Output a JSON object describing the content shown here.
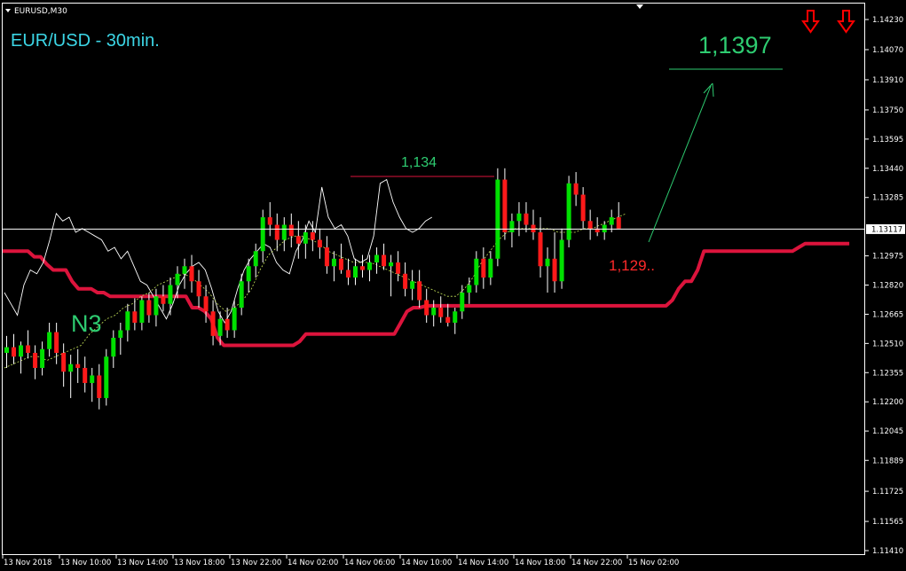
{
  "window": {
    "symbol_label": "EURUSD,M30"
  },
  "annotations": {
    "title": "EUR/USD - 30min.",
    "wave_label": "N3",
    "resistance_label": "1,134",
    "support_label": "1,129..",
    "target_label": "1,1397"
  },
  "price_axis": {
    "current_price": "1.13117"
  },
  "colors": {
    "background": "#000000",
    "bull_candle": "#00e000",
    "bear_candle": "#ff1a1a",
    "kijun_line": "#dc143c",
    "text_cyan": "#3cd6e6",
    "text_green": "#2ecc71",
    "text_red": "#ff2a2a",
    "arrow_red": "#ff0000"
  },
  "icons": [
    "down-arrow-icon",
    "down-arrow-icon",
    "collapse-triangle-icon",
    "expand-triangle-icon"
  ],
  "chart_data": {
    "type": "candlestick",
    "symbol": "EURUSD",
    "timeframe": "M30",
    "ylim": [
      1.1141,
      1.1423
    ],
    "yticks": [
      "1.14230",
      "1.14070",
      "1.13910",
      "1.13750",
      "1.13595",
      "1.13440",
      "1.13285",
      "1.13117",
      "1.12975",
      "1.12820",
      "1.12665",
      "1.12510",
      "1.12355",
      "1.12200",
      "1.12045",
      "1.11889",
      "1.11725",
      "1.11565",
      "1.11410"
    ],
    "xticks": [
      "13 Nov 2018",
      "13 Nov 10:00",
      "13 Nov 14:00",
      "13 Nov 18:00",
      "13 Nov 22:00",
      "14 Nov 02:00",
      "14 Nov 06:00",
      "14 Nov 10:00",
      "14 Nov 14:00",
      "14 Nov 18:00",
      "14 Nov 22:00",
      "15 Nov 02:00"
    ],
    "candles": [
      {
        "o": 1.1246,
        "h": 1.1255,
        "l": 1.1238,
        "c": 1.1249
      },
      {
        "o": 1.1249,
        "h": 1.1256,
        "l": 1.124,
        "c": 1.1244
      },
      {
        "o": 1.1244,
        "h": 1.1252,
        "l": 1.1235,
        "c": 1.125
      },
      {
        "o": 1.125,
        "h": 1.1258,
        "l": 1.1243,
        "c": 1.1246
      },
      {
        "o": 1.1246,
        "h": 1.125,
        "l": 1.1232,
        "c": 1.1238
      },
      {
        "o": 1.1238,
        "h": 1.1252,
        "l": 1.1234,
        "c": 1.1248
      },
      {
        "o": 1.1248,
        "h": 1.1262,
        "l": 1.1244,
        "c": 1.1257
      },
      {
        "o": 1.1257,
        "h": 1.1262,
        "l": 1.124,
        "c": 1.1246
      },
      {
        "o": 1.1246,
        "h": 1.1251,
        "l": 1.1228,
        "c": 1.1236
      },
      {
        "o": 1.1236,
        "h": 1.1245,
        "l": 1.1222,
        "c": 1.124
      },
      {
        "o": 1.124,
        "h": 1.1248,
        "l": 1.123,
        "c": 1.1238
      },
      {
        "o": 1.1238,
        "h": 1.1244,
        "l": 1.1225,
        "c": 1.123
      },
      {
        "o": 1.123,
        "h": 1.1238,
        "l": 1.122,
        "c": 1.1234
      },
      {
        "o": 1.1234,
        "h": 1.124,
        "l": 1.1216,
        "c": 1.1222
      },
      {
        "o": 1.1222,
        "h": 1.1248,
        "l": 1.1218,
        "c": 1.1244
      },
      {
        "o": 1.1244,
        "h": 1.1258,
        "l": 1.1238,
        "c": 1.1254
      },
      {
        "o": 1.1254,
        "h": 1.1262,
        "l": 1.1245,
        "c": 1.1258
      },
      {
        "o": 1.1258,
        "h": 1.1272,
        "l": 1.1252,
        "c": 1.1268
      },
      {
        "o": 1.1268,
        "h": 1.1275,
        "l": 1.1258,
        "c": 1.1262
      },
      {
        "o": 1.1262,
        "h": 1.1276,
        "l": 1.1258,
        "c": 1.1274
      },
      {
        "o": 1.1274,
        "h": 1.1278,
        "l": 1.1262,
        "c": 1.1266
      },
      {
        "o": 1.1266,
        "h": 1.128,
        "l": 1.126,
        "c": 1.1276
      },
      {
        "o": 1.1276,
        "h": 1.1282,
        "l": 1.1268,
        "c": 1.1272
      },
      {
        "o": 1.1272,
        "h": 1.1286,
        "l": 1.1266,
        "c": 1.1282
      },
      {
        "o": 1.1282,
        "h": 1.1292,
        "l": 1.1275,
        "c": 1.1288
      },
      {
        "o": 1.1288,
        "h": 1.1296,
        "l": 1.128,
        "c": 1.1292
      },
      {
        "o": 1.1292,
        "h": 1.1298,
        "l": 1.1278,
        "c": 1.1284
      },
      {
        "o": 1.1284,
        "h": 1.129,
        "l": 1.127,
        "c": 1.1276
      },
      {
        "o": 1.1276,
        "h": 1.1282,
        "l": 1.1262,
        "c": 1.1268
      },
      {
        "o": 1.1268,
        "h": 1.1274,
        "l": 1.125,
        "c": 1.1255
      },
      {
        "o": 1.1255,
        "h": 1.1268,
        "l": 1.125,
        "c": 1.1264
      },
      {
        "o": 1.1264,
        "h": 1.127,
        "l": 1.1254,
        "c": 1.1258
      },
      {
        "o": 1.1258,
        "h": 1.1274,
        "l": 1.1254,
        "c": 1.127
      },
      {
        "o": 1.127,
        "h": 1.1288,
        "l": 1.1266,
        "c": 1.1284
      },
      {
        "o": 1.1284,
        "h": 1.1296,
        "l": 1.1278,
        "c": 1.1292
      },
      {
        "o": 1.1292,
        "h": 1.1304,
        "l": 1.1286,
        "c": 1.13
      },
      {
        "o": 1.13,
        "h": 1.1322,
        "l": 1.1294,
        "c": 1.1318
      },
      {
        "o": 1.1318,
        "h": 1.1326,
        "l": 1.1308,
        "c": 1.1314
      },
      {
        "o": 1.1314,
        "h": 1.132,
        "l": 1.13,
        "c": 1.1306
      },
      {
        "o": 1.1306,
        "h": 1.1318,
        "l": 1.13,
        "c": 1.1314
      },
      {
        "o": 1.1314,
        "h": 1.132,
        "l": 1.1302,
        "c": 1.1308
      },
      {
        "o": 1.1308,
        "h": 1.1316,
        "l": 1.1296,
        "c": 1.1304
      },
      {
        "o": 1.1304,
        "h": 1.1314,
        "l": 1.1296,
        "c": 1.131
      },
      {
        "o": 1.131,
        "h": 1.1316,
        "l": 1.13,
        "c": 1.1306
      },
      {
        "o": 1.1306,
        "h": 1.1312,
        "l": 1.1296,
        "c": 1.1302
      },
      {
        "o": 1.1302,
        "h": 1.1308,
        "l": 1.1288,
        "c": 1.1292
      },
      {
        "o": 1.1292,
        "h": 1.13,
        "l": 1.1284,
        "c": 1.1296
      },
      {
        "o": 1.1296,
        "h": 1.1304,
        "l": 1.1288,
        "c": 1.129
      },
      {
        "o": 1.129,
        "h": 1.1296,
        "l": 1.1282,
        "c": 1.1286
      },
      {
        "o": 1.1286,
        "h": 1.1296,
        "l": 1.1282,
        "c": 1.1292
      },
      {
        "o": 1.1292,
        "h": 1.1298,
        "l": 1.1286,
        "c": 1.129
      },
      {
        "o": 1.129,
        "h": 1.1298,
        "l": 1.1284,
        "c": 1.1294
      },
      {
        "o": 1.1294,
        "h": 1.1302,
        "l": 1.1288,
        "c": 1.1298
      },
      {
        "o": 1.1298,
        "h": 1.1304,
        "l": 1.129,
        "c": 1.1292
      },
      {
        "o": 1.1292,
        "h": 1.1298,
        "l": 1.1276,
        "c": 1.1294
      },
      {
        "o": 1.1294,
        "h": 1.13,
        "l": 1.1284,
        "c": 1.1288
      },
      {
        "o": 1.1288,
        "h": 1.1294,
        "l": 1.1276,
        "c": 1.128
      },
      {
        "o": 1.128,
        "h": 1.129,
        "l": 1.1274,
        "c": 1.1284
      },
      {
        "o": 1.1284,
        "h": 1.129,
        "l": 1.127,
        "c": 1.1274
      },
      {
        "o": 1.1274,
        "h": 1.128,
        "l": 1.1262,
        "c": 1.1266
      },
      {
        "o": 1.1266,
        "h": 1.1274,
        "l": 1.126,
        "c": 1.127
      },
      {
        "o": 1.127,
        "h": 1.1276,
        "l": 1.1262,
        "c": 1.1265
      },
      {
        "o": 1.1265,
        "h": 1.1272,
        "l": 1.126,
        "c": 1.1262
      },
      {
        "o": 1.1262,
        "h": 1.127,
        "l": 1.1256,
        "c": 1.1268
      },
      {
        "o": 1.1268,
        "h": 1.1282,
        "l": 1.1264,
        "c": 1.1278
      },
      {
        "o": 1.1278,
        "h": 1.1286,
        "l": 1.1272,
        "c": 1.1282
      },
      {
        "o": 1.1282,
        "h": 1.13,
        "l": 1.1278,
        "c": 1.1296
      },
      {
        "o": 1.1296,
        "h": 1.1302,
        "l": 1.128,
        "c": 1.1286
      },
      {
        "o": 1.1286,
        "h": 1.13,
        "l": 1.1282,
        "c": 1.1296
      },
      {
        "o": 1.1296,
        "h": 1.1344,
        "l": 1.1292,
        "c": 1.1338
      },
      {
        "o": 1.1338,
        "h": 1.1344,
        "l": 1.1306,
        "c": 1.131
      },
      {
        "o": 1.131,
        "h": 1.132,
        "l": 1.1302,
        "c": 1.1316
      },
      {
        "o": 1.1316,
        "h": 1.1326,
        "l": 1.1308,
        "c": 1.132
      },
      {
        "o": 1.132,
        "h": 1.1326,
        "l": 1.131,
        "c": 1.1314
      },
      {
        "o": 1.1314,
        "h": 1.1322,
        "l": 1.1306,
        "c": 1.131
      },
      {
        "o": 1.131,
        "h": 1.1318,
        "l": 1.1286,
        "c": 1.1292
      },
      {
        "o": 1.1292,
        "h": 1.1302,
        "l": 1.1278,
        "c": 1.1296
      },
      {
        "o": 1.1296,
        "h": 1.131,
        "l": 1.1278,
        "c": 1.1284
      },
      {
        "o": 1.1284,
        "h": 1.1312,
        "l": 1.128,
        "c": 1.1306
      },
      {
        "o": 1.1306,
        "h": 1.134,
        "l": 1.1302,
        "c": 1.1336
      },
      {
        "o": 1.1336,
        "h": 1.1342,
        "l": 1.1324,
        "c": 1.133
      },
      {
        "o": 1.133,
        "h": 1.1334,
        "l": 1.1312,
        "c": 1.1316
      },
      {
        "o": 1.1316,
        "h": 1.1322,
        "l": 1.1306,
        "c": 1.1312
      },
      {
        "o": 1.1312,
        "h": 1.1318,
        "l": 1.1308,
        "c": 1.131
      },
      {
        "o": 1.131,
        "h": 1.1316,
        "l": 1.1306,
        "c": 1.1314
      },
      {
        "o": 1.1314,
        "h": 1.1322,
        "l": 1.131,
        "c": 1.1318
      },
      {
        "o": 1.1318,
        "h": 1.1326,
        "l": 1.1312,
        "c": 1.1312
      }
    ],
    "kijun": [
      1.13,
      1.13,
      1.13,
      1.13,
      1.13,
      1.1297,
      1.1297,
      1.1293,
      1.129,
      1.129,
      1.129,
      1.1284,
      1.128,
      1.128,
      1.128,
      1.1278,
      1.1278,
      1.1276,
      1.1276,
      1.1276,
      1.1276,
      1.1276,
      1.1276,
      1.1276,
      1.1276,
      1.1276,
      1.1276,
      1.1276,
      1.1276,
      1.1276,
      1.127,
      1.127,
      1.1268,
      1.1264,
      1.1254,
      1.125,
      1.125,
      1.125,
      1.125,
      1.125,
      1.125,
      1.125,
      1.125,
      1.125,
      1.125,
      1.125,
      1.125,
      1.1252,
      1.1256,
      1.1256,
      1.1256,
      1.1256,
      1.1256,
      1.1256,
      1.1256,
      1.1256,
      1.1256,
      1.1256,
      1.1256,
      1.1256,
      1.1256,
      1.1256,
      1.1256,
      1.1262,
      1.1268,
      1.127,
      1.127,
      1.1271,
      1.1271,
      1.1271,
      1.1271,
      1.1271,
      1.1271,
      1.1271,
      1.1271,
      1.1271,
      1.1271,
      1.1271,
      1.1271,
      1.1271,
      1.1271,
      1.1271,
      1.1271,
      1.1271,
      1.1271,
      1.1271,
      1.1271,
      1.1271,
      1.1271,
      1.1271,
      1.1271,
      1.1271,
      1.1271,
      1.1271,
      1.1271,
      1.1271,
      1.1271,
      1.1271,
      1.1271,
      1.1271,
      1.1271,
      1.1271,
      1.1271,
      1.1271,
      1.1271,
      1.1271,
      1.1274,
      1.128,
      1.1284,
      1.1284,
      1.129,
      1.13,
      1.13,
      1.13,
      1.13,
      1.13,
      1.13,
      1.13,
      1.13,
      1.13,
      1.13,
      1.13,
      1.13,
      1.13,
      1.13,
      1.13,
      1.1302,
      1.1304,
      1.1304,
      1.1304,
      1.1304,
      1.1304,
      1.1304,
      1.1304,
      1.1304
    ],
    "chikou": [
      1.1278,
      1.1272,
      1.1266,
      1.1282,
      1.129,
      1.1288,
      1.1294,
      1.1306,
      1.132,
      1.1316,
      1.1318,
      1.131,
      1.1312,
      1.131,
      1.1308,
      1.1306,
      1.13,
      1.1302,
      1.1296,
      1.13,
      1.1292,
      1.1284,
      1.1282,
      1.1276,
      1.127,
      1.1264,
      1.1272,
      1.1282,
      1.1288,
      1.1292,
      1.1294,
      1.129,
      1.128,
      1.1268,
      1.1262,
      1.1268,
      1.128,
      1.129,
      1.1296,
      1.13,
      1.1304,
      1.1302,
      1.1294,
      1.129,
      1.1288,
      1.13,
      1.1306,
      1.1316,
      1.131,
      1.1334,
      1.1318,
      1.1312,
      1.1314,
      1.1308,
      1.1296,
      1.1294,
      1.1296,
      1.1308,
      1.1336,
      1.1338,
      1.1326,
      1.1318,
      1.1312,
      1.131,
      1.1312,
      1.1316,
      1.1318
    ],
    "tenkan": [
      1.1238,
      1.124,
      1.1242,
      1.1244,
      1.1244,
      1.1242,
      1.1244,
      1.1246,
      1.1248,
      1.125,
      1.1256,
      1.126,
      1.1264,
      1.1266,
      1.127,
      1.1272,
      1.1276,
      1.1278,
      1.1282,
      1.1284,
      1.1286,
      1.1288,
      1.1286,
      1.1282,
      1.1278,
      1.1272,
      1.1268,
      1.127,
      1.1274,
      1.128,
      1.129,
      1.1298,
      1.1302,
      1.1306,
      1.1308,
      1.1308,
      1.1306,
      1.1304,
      1.13,
      1.1298,
      1.1296,
      1.1294,
      1.1294,
      1.1294,
      1.1292,
      1.129,
      1.1288,
      1.1286,
      1.1284,
      1.1282,
      1.128,
      1.1278,
      1.1276,
      1.1276,
      1.128,
      1.1286,
      1.1294,
      1.13,
      1.1306,
      1.131,
      1.1312,
      1.1312,
      1.1312,
      1.1312,
      1.1312,
      1.131,
      1.131,
      1.131,
      1.1312,
      1.1312,
      1.1314,
      1.1316,
      1.1318,
      1.132
    ]
  }
}
